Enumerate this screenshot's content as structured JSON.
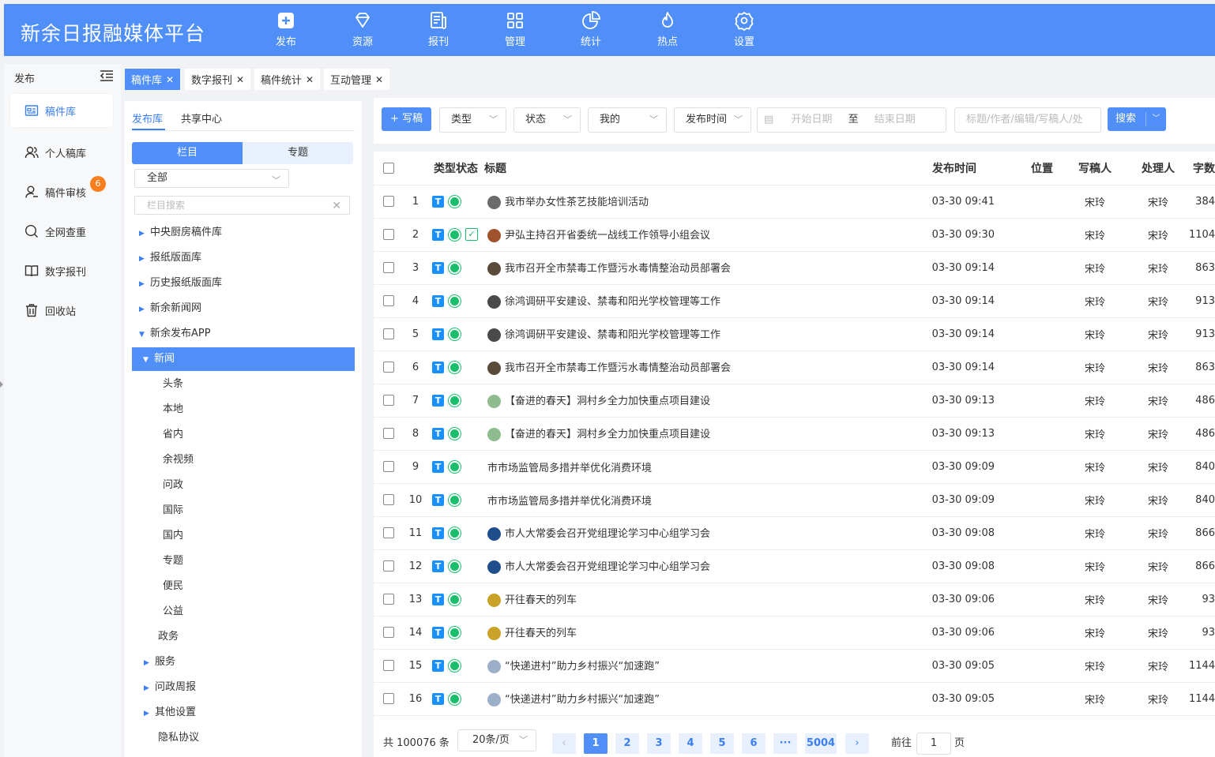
{
  "header": {
    "brand": "新余日报融媒体平台",
    "nav": [
      {
        "label": "发布",
        "icon": "plus-square-icon"
      },
      {
        "label": "资源",
        "icon": "diamond-icon"
      },
      {
        "label": "报刊",
        "icon": "newspaper-icon"
      },
      {
        "label": "管理",
        "icon": "grid-icon"
      },
      {
        "label": "统计",
        "icon": "pie-chart-icon"
      },
      {
        "label": "热点",
        "icon": "flame-icon"
      },
      {
        "label": "设置",
        "icon": "gear-icon"
      }
    ]
  },
  "sidebar": {
    "title": "发布",
    "items": [
      {
        "label": "稿件库",
        "icon": "manuscript-icon"
      },
      {
        "label": "个人稿库",
        "icon": "person-icon"
      },
      {
        "label": "稿件审核",
        "icon": "review-icon",
        "badge": "6"
      },
      {
        "label": "全网查重",
        "icon": "search-icon"
      },
      {
        "label": "数字报刊",
        "icon": "book-icon"
      },
      {
        "label": "回收站",
        "icon": "trash-icon"
      }
    ]
  },
  "tabs": [
    "稿件库",
    "数字报刊",
    "稿件统计",
    "互动管理"
  ],
  "tree": {
    "subtabs": [
      "发布库",
      "共享中心"
    ],
    "segments": [
      "栏目",
      "专题"
    ],
    "select_value": "全部",
    "search_placeholder": "栏目搜索",
    "nodes": [
      {
        "label": "中央厨房稿件库"
      },
      {
        "label": "报纸版面库"
      },
      {
        "label": "历史报纸版面库"
      },
      {
        "label": "新余新闻网"
      },
      {
        "label": "新余发布APP"
      },
      {
        "label": "新闻"
      },
      {
        "label": "头条"
      },
      {
        "label": "本地"
      },
      {
        "label": "省内"
      },
      {
        "label": "余视频"
      },
      {
        "label": "问政"
      },
      {
        "label": "国际"
      },
      {
        "label": "国内"
      },
      {
        "label": "专题"
      },
      {
        "label": "便民"
      },
      {
        "label": "公益"
      },
      {
        "label": "政务"
      },
      {
        "label": "服务"
      },
      {
        "label": "问政周报"
      },
      {
        "label": "其他设置"
      },
      {
        "label": "隐私协议"
      }
    ]
  },
  "toolbar": {
    "write_label": "+ 写稿",
    "type_label": "类型",
    "status_label": "状态",
    "mine_label": "我的",
    "pubtime_label": "发布时间",
    "start_placeholder": "开始日期",
    "to_label": "至",
    "end_placeholder": "结束日期",
    "keyword_placeholder": "标题/作者/编辑/写稿人/处",
    "search_label": "搜索"
  },
  "table": {
    "headers": [
      "类型状态",
      "标题",
      "发布时间",
      "位置",
      "写稿人",
      "处理人",
      "字数"
    ],
    "rows": [
      {
        "no": "1",
        "title": "我市举办女性茶艺技能培训活动",
        "time": "03-30 09:41",
        "writer": "宋玲",
        "handler": "宋玲",
        "words": "384",
        "thumb": "#6b6b6b",
        "check": false
      },
      {
        "no": "2",
        "title": "尹弘主持召开省委统一战线工作领导小组会议",
        "time": "03-30 09:30",
        "writer": "宋玲",
        "handler": "宋玲",
        "words": "1104",
        "thumb": "#a0522d",
        "check": true
      },
      {
        "no": "3",
        "title": "我市召开全市禁毒工作暨污水毒情整治动员部署会",
        "time": "03-30 09:14",
        "writer": "宋玲",
        "handler": "宋玲",
        "words": "863",
        "thumb": "#5a4a3a",
        "check": false
      },
      {
        "no": "4",
        "title": "徐鸿调研平安建设、禁毒和阳光学校管理等工作",
        "time": "03-30 09:14",
        "writer": "宋玲",
        "handler": "宋玲",
        "words": "913",
        "thumb": "#4a4a4a",
        "check": false
      },
      {
        "no": "5",
        "title": "徐鸿调研平安建设、禁毒和阳光学校管理等工作",
        "time": "03-30 09:14",
        "writer": "宋玲",
        "handler": "宋玲",
        "words": "913",
        "thumb": "#4a4a4a",
        "check": false
      },
      {
        "no": "6",
        "title": "我市召开全市禁毒工作暨污水毒情整治动员部署会",
        "time": "03-30 09:14",
        "writer": "宋玲",
        "handler": "宋玲",
        "words": "863",
        "thumb": "#5a4a3a",
        "check": false
      },
      {
        "no": "7",
        "title": "【奋进的春天】洞村乡全力加快重点项目建设",
        "time": "03-30 09:13",
        "writer": "宋玲",
        "handler": "宋玲",
        "words": "486",
        "thumb": "#8fbc8f",
        "check": false
      },
      {
        "no": "8",
        "title": "【奋进的春天】洞村乡全力加快重点项目建设",
        "time": "03-30 09:13",
        "writer": "宋玲",
        "handler": "宋玲",
        "words": "486",
        "thumb": "#8fbc8f",
        "check": false
      },
      {
        "no": "9",
        "title": "市市场监管局多措并举优化消费环境",
        "time": "03-30 09:09",
        "writer": "宋玲",
        "handler": "宋玲",
        "words": "840",
        "thumb": "",
        "check": false
      },
      {
        "no": "10",
        "title": "市市场监管局多措并举优化消费环境",
        "time": "03-30 09:09",
        "writer": "宋玲",
        "handler": "宋玲",
        "words": "840",
        "thumb": "",
        "check": false
      },
      {
        "no": "11",
        "title": "市人大常委会召开党组理论学习中心组学习会",
        "time": "03-30 09:08",
        "writer": "宋玲",
        "handler": "宋玲",
        "words": "866",
        "thumb": "#1f4e8c",
        "check": false
      },
      {
        "no": "12",
        "title": "市人大常委会召开党组理论学习中心组学习会",
        "time": "03-30 09:08",
        "writer": "宋玲",
        "handler": "宋玲",
        "words": "866",
        "thumb": "#1f4e8c",
        "check": false
      },
      {
        "no": "13",
        "title": "开往春天的列车",
        "time": "03-30 09:06",
        "writer": "宋玲",
        "handler": "宋玲",
        "words": "93",
        "thumb": "#c9a227",
        "check": false
      },
      {
        "no": "14",
        "title": "开往春天的列车",
        "time": "03-30 09:06",
        "writer": "宋玲",
        "handler": "宋玲",
        "words": "93",
        "thumb": "#c9a227",
        "check": false
      },
      {
        "no": "15",
        "title": "“快递进村”助力乡村振兴“加速跑”",
        "time": "03-30 09:05",
        "writer": "宋玲",
        "handler": "宋玲",
        "words": "1144",
        "thumb": "#9bb0c8",
        "check": false
      },
      {
        "no": "16",
        "title": "“快递进村”助力乡村振兴“加速跑”",
        "time": "03-30 09:05",
        "writer": "宋玲",
        "handler": "宋玲",
        "words": "1144",
        "thumb": "#9bb0c8",
        "check": false
      }
    ]
  },
  "pager": {
    "total": "共 100076 条",
    "page_size": "20条/页",
    "pages": [
      "1",
      "2",
      "3",
      "4",
      "5",
      "6",
      "···",
      "5004"
    ],
    "current": "1",
    "goto_label": "前往",
    "goto_value": "1",
    "page_suffix": "页"
  }
}
